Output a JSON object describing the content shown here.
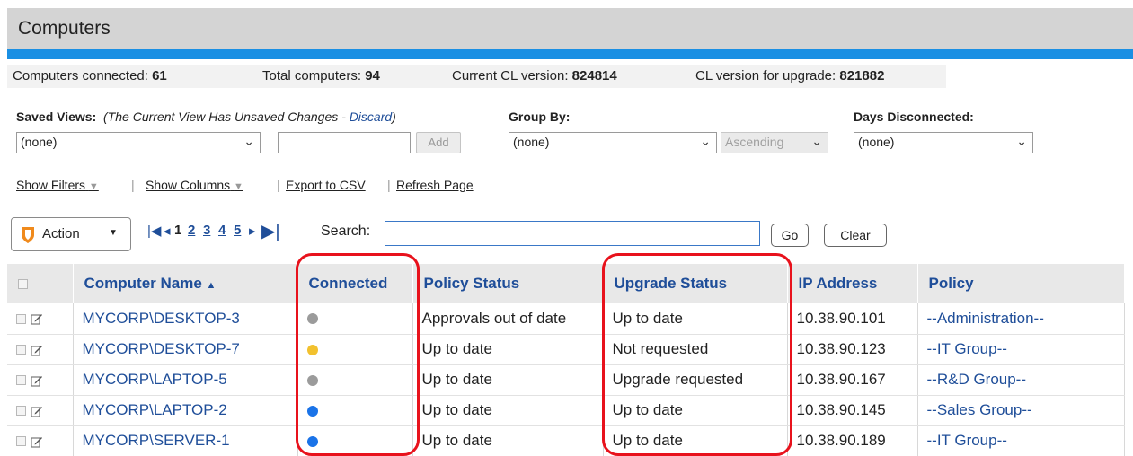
{
  "title": "Computers",
  "stats": {
    "connected_label": "Computers connected:",
    "connected_value": "61",
    "total_label": "Total computers:",
    "total_value": "94",
    "cl_label": "Current CL version:",
    "cl_value": "824814",
    "upgrade_label": "CL version for upgrade:",
    "upgrade_value": "821882"
  },
  "filters": {
    "saved_views_label": "Saved Views:",
    "saved_views_note_prefix": "(The Current View Has Unsaved Changes -",
    "saved_views_discard": "Discard",
    "saved_views_note_suffix": ")",
    "saved_views_value": "(none)",
    "add_label": "Add",
    "group_by_label": "Group By:",
    "group_by_value": "(none)",
    "order_value": "Ascending",
    "days_label": "Days Disconnected:",
    "days_value": "(none)"
  },
  "links": {
    "show_filters": "Show Filters",
    "show_columns": "Show Columns",
    "export_csv": "Export to CSV",
    "refresh_page": "Refresh Page"
  },
  "toolbar": {
    "action_label": "Action",
    "pages": [
      "1",
      "2",
      "3",
      "4",
      "5"
    ],
    "search_label": "Search:",
    "search_value": "",
    "go_label": "Go",
    "clear_label": "Clear"
  },
  "table": {
    "columns": [
      "Computer Name",
      "Connected",
      "Policy Status",
      "Upgrade Status",
      "IP Address",
      "Policy"
    ],
    "rows": [
      {
        "name": "MYCORP\\DESKTOP-3",
        "connected": "gray",
        "policy_status": "Approvals out of date",
        "upgrade_status": "Up to date",
        "ip": "10.38.90.101",
        "policy": "--Administration--"
      },
      {
        "name": "MYCORP\\DESKTOP-7",
        "connected": "yellow",
        "policy_status": "Up to date",
        "upgrade_status": "Not requested",
        "ip": "10.38.90.123",
        "policy": "--IT Group--"
      },
      {
        "name": "MYCORP\\LAPTOP-5",
        "connected": "gray",
        "policy_status": "Up to date",
        "upgrade_status": "Upgrade requested",
        "ip": "10.38.90.167",
        "policy": "--R&D Group--"
      },
      {
        "name": "MYCORP\\LAPTOP-2",
        "connected": "blue",
        "policy_status": "Up to date",
        "upgrade_status": "Up to date",
        "ip": "10.38.90.145",
        "policy": "--Sales Group--"
      },
      {
        "name": "MYCORP\\SERVER-1",
        "connected": "blue",
        "policy_status": "Up to date",
        "upgrade_status": "Up to date",
        "ip": "10.38.90.189",
        "policy": "--IT Group--"
      }
    ]
  },
  "colors": {
    "gray": "#9b9b9b",
    "yellow": "#f2c12e",
    "blue": "#1a73e8",
    "accent": "#1a8fe3",
    "highlight": "#e8121c"
  }
}
